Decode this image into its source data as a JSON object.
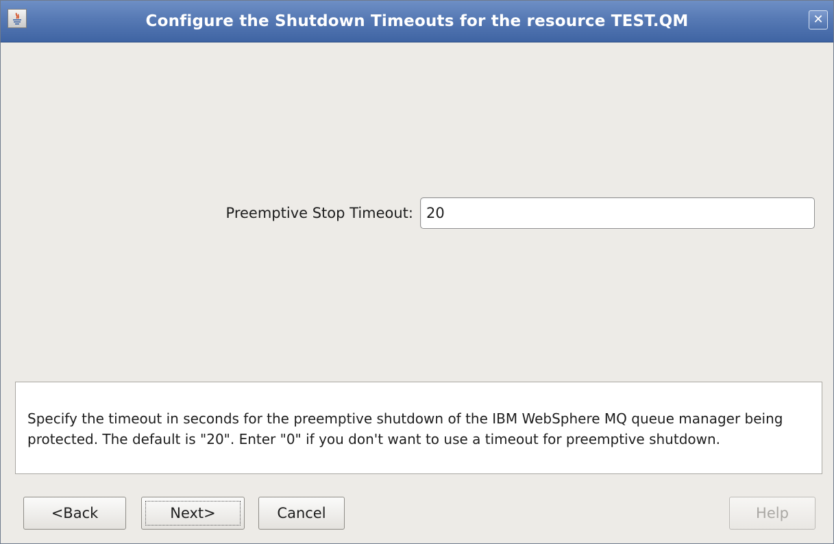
{
  "window": {
    "title": "Configure the Shutdown Timeouts for the resource TEST.QM",
    "app_icon": "java-icon",
    "close_icon": "close-icon",
    "close_glyph": "✕"
  },
  "form": {
    "timeout_label": "Preemptive Stop Timeout:",
    "timeout_value": "20"
  },
  "description": {
    "text": "Specify the timeout in seconds for the preemptive shutdown of the IBM WebSphere MQ queue manager being protected. The default is \"20\". Enter \"0\" if you don't want to use a timeout for preemptive shutdown."
  },
  "buttons": {
    "back": "<Back",
    "next": "Next>",
    "cancel": "Cancel",
    "help": "Help"
  },
  "colors": {
    "titlebar": "#4f72ae",
    "background": "#edebe7",
    "disabled_text": "#a9a7a3"
  }
}
